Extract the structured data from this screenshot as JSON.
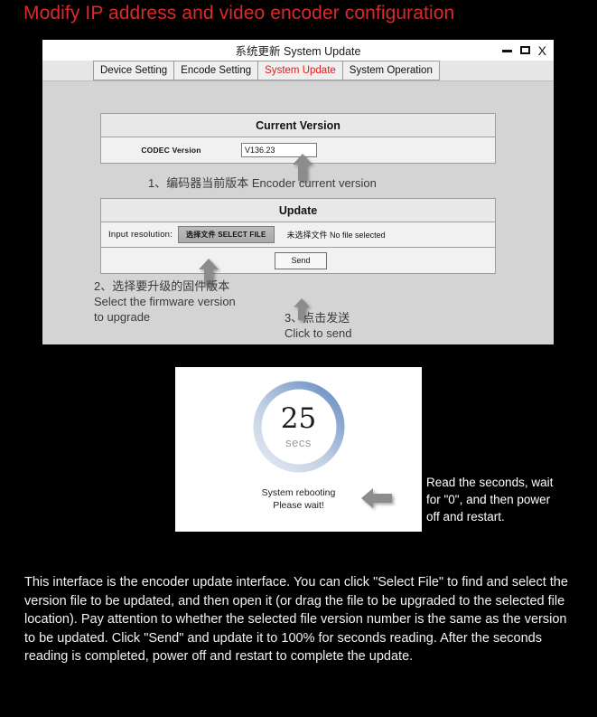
{
  "heading": "Modify IP address and video encoder configuration",
  "window": {
    "title": "系统更新  System Update",
    "controls": {
      "minimize": "minimize-icon",
      "maximize": "maximize-icon",
      "close": "X"
    },
    "tabs": [
      {
        "label": "Device Setting",
        "active": false
      },
      {
        "label": "Encode Setting",
        "active": false
      },
      {
        "label": "System Update",
        "active": true
      },
      {
        "label": "System Operation",
        "active": false
      }
    ],
    "current_version": {
      "header": "Current Version",
      "row_label": "CODEC Version",
      "value": "V136.23"
    },
    "update": {
      "header": "Update",
      "input_label": "Input resolution:",
      "select_file_button": "选择文件 SELECT FILE",
      "no_file_text": "未选择文件 No file selected",
      "send_button": "Send"
    },
    "annotations": {
      "step1": "1、编码器当前版本  Encoder current version",
      "step2": "2、选择要升级的固件版本\nSelect the firmware version\nto upgrade",
      "step3": "3、点击发送\nClick to send"
    }
  },
  "reboot": {
    "seconds": "25",
    "unit": "secs",
    "message": "System rebooting\nPlease wait!",
    "ring_color_dark": "#6f93c4",
    "ring_color_light": "#dfe6f0"
  },
  "side_note": "Read the seconds, wait\nfor \"0\", and then power\noff and restart.",
  "bottom_paragraph": "This interface is the encoder update interface. You can click \"Select File\" to find and select the version file to be updated, and then open it (or drag the file to be upgraded to the selected file location). Pay attention to whether the selected file version number is the same as the version to be updated. Click \"Send\" and update it to 100% for seconds reading. After the seconds reading is completed, power off and restart to complete the update.",
  "colors": {
    "heading": "#d92b2b",
    "active_tab": "#e01b1b",
    "window_bg": "#d4d4d4"
  }
}
